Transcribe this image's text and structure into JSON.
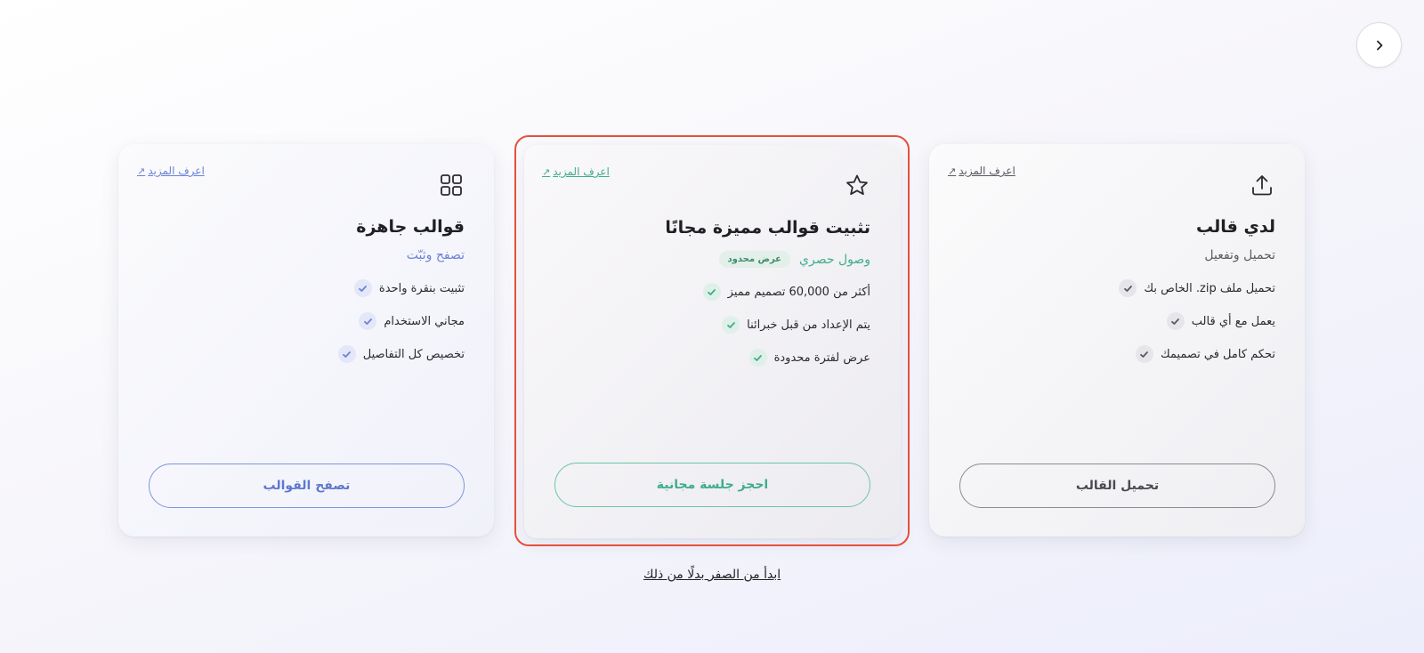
{
  "colors": {
    "templates_accent": "#6b83d6",
    "premium_accent": "#3fae88",
    "upload_accent": "#5a5a62",
    "highlight": "#e5503c"
  },
  "nav": {
    "next_icon": "chevron-right-icon"
  },
  "cards": [
    {
      "id": "templates",
      "icon": "grid-icon",
      "more_link": "اعرف المزيد",
      "title": "قوالب جاهزة",
      "subtitle": "تصفح وثبّت",
      "features": [
        "تثبيت بنقرة واحدة",
        "مجاني الاستخدام",
        "تخصيص كل التفاصيل"
      ],
      "cta": "تصفح القوالب"
    },
    {
      "id": "premium",
      "icon": "star-icon",
      "more_link": "اعرف المزيد",
      "title": "تثبيت قوالب مميزة مجانًا",
      "subtitle": "وصول حصري",
      "badge": "عرض محدود",
      "features": [
        "أكثر من 60,000 تصميم مميز",
        "يتم الإعداد من قبل خبرائنا",
        "عرض لفترة محدودة"
      ],
      "cta": "احجز جلسة مجانية"
    },
    {
      "id": "upload",
      "icon": "upload-icon",
      "more_link": "اعرف المزيد",
      "title": "لدي قالب",
      "subtitle": "تحميل وتفعيل",
      "features": [
        "تحميل ملف zip. الخاص بك",
        "يعمل مع أي قالب",
        "تحكم كامل في تصميمك"
      ],
      "cta": "تحميل القالب"
    }
  ],
  "footer": {
    "start_scratch": "ابدأ من الصفر بدلًا من ذلك"
  }
}
